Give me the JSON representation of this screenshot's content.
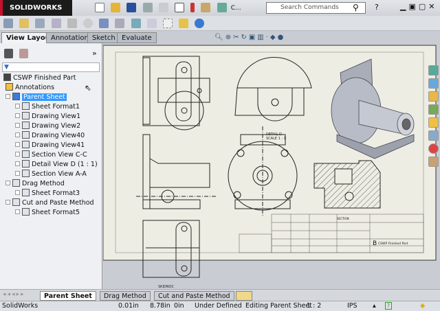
{
  "app": {
    "logo": "SOLIDWORKS",
    "search_placeholder": "Search Commands",
    "overflow": "C..."
  },
  "tabs": [
    {
      "label": "View Layout",
      "active": true
    },
    {
      "label": "Annotation"
    },
    {
      "label": "Sketch"
    },
    {
      "label": "Evaluate"
    }
  ],
  "tree": {
    "root": "CSWP Finished Part",
    "items": [
      {
        "label": "Annotations",
        "level": 1,
        "icon": "annotations-icon"
      },
      {
        "label": "Parent Sheet",
        "level": 1,
        "icon": "sheet-icon",
        "selected": true
      },
      {
        "label": "Sheet Format1",
        "level": 2,
        "icon": "sheet-format-icon"
      },
      {
        "label": "Drawing View1",
        "level": 2,
        "icon": "drawing-view-icon"
      },
      {
        "label": "Drawing View2",
        "level": 2,
        "icon": "drawing-view-icon"
      },
      {
        "label": "Drawing View40",
        "level": 2,
        "icon": "drawing-view-icon"
      },
      {
        "label": "Drawing View41",
        "level": 2,
        "icon": "drawing-view-icon"
      },
      {
        "label": "Section View C-C",
        "level": 2,
        "icon": "section-view-icon"
      },
      {
        "label": "Detail View D (1 : 1)",
        "level": 2,
        "icon": "detail-view-icon"
      },
      {
        "label": "Section View A-A",
        "level": 2,
        "icon": "section-view-icon"
      },
      {
        "label": "Drag Method",
        "level": 1,
        "icon": "sheet-icon"
      },
      {
        "label": "Sheet Format3",
        "level": 2,
        "icon": "sheet-format-icon"
      },
      {
        "label": "Cut and Paste Method",
        "level": 1,
        "icon": "sheet-icon"
      },
      {
        "label": "Sheet Format5",
        "level": 2,
        "icon": "sheet-format-icon"
      }
    ]
  },
  "drawing": {
    "detail_label": "DETAIL D",
    "detail_scale": "SCALE 1 : 1",
    "section_label": "SECTION",
    "title_block_part": "CSWP Finished Part",
    "sheet_size": "B",
    "bottom_label": "SKIDNOC"
  },
  "sheet_tabs": [
    {
      "label": "Parent Sheet",
      "active": true
    },
    {
      "label": "Drag Method"
    },
    {
      "label": "Cut and Paste Method"
    }
  ],
  "status": {
    "app": "SolidWorks",
    "x": "0.01in",
    "y": "8.78in",
    "z": "0in",
    "state": "Under Defined",
    "editing": "Editing Parent Sheet",
    "scale": "1 : 2",
    "units": "IPS"
  },
  "colors": {
    "selection": "#3399ff",
    "sheet": "#eeede3",
    "logo_bg": "#1b1b1b"
  }
}
